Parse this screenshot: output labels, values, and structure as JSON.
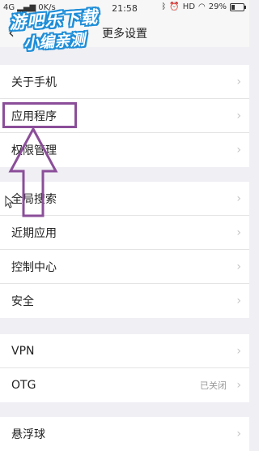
{
  "status_bar": {
    "network": "4G",
    "speed": "0K/s",
    "time": "21:58",
    "hd": "HD",
    "battery": "29%",
    "battery_level": 0.29
  },
  "navbar": {
    "title": "更多设置"
  },
  "watermark": {
    "line1": "游吧乐下载",
    "line2": "小编亲测"
  },
  "groups": [
    {
      "items": [
        {
          "label": "关于手机"
        },
        {
          "label": "应用程序"
        },
        {
          "label": "权限管理"
        }
      ]
    },
    {
      "items": [
        {
          "label": "全局搜索"
        },
        {
          "label": "近期应用"
        },
        {
          "label": "控制中心"
        },
        {
          "label": "安全"
        }
      ]
    },
    {
      "items": [
        {
          "label": "VPN"
        },
        {
          "label": "OTG",
          "value": "已关闭"
        }
      ]
    },
    {
      "items": [
        {
          "label": "悬浮球"
        }
      ]
    }
  ],
  "icons": {
    "chevron": "›",
    "back": "‹"
  },
  "colors": {
    "highlight": "#8b4e99",
    "background": "#efeff4",
    "watermark_outline": "#1f8ed8"
  }
}
